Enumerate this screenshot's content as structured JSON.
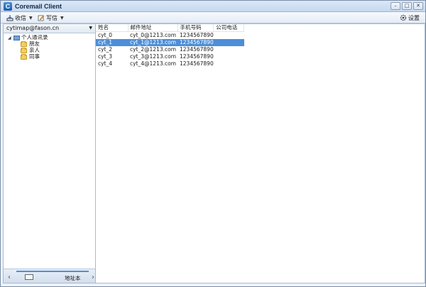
{
  "window": {
    "title": "Coremail Client",
    "icon_letter": "C"
  },
  "window_buttons": {
    "minimize": "–",
    "maximize": "□",
    "close": "✕"
  },
  "toolbar": {
    "receive": "收信",
    "write": "写信",
    "settings": "设置"
  },
  "sidebar": {
    "account": "cytimap@fason.cn",
    "tree": {
      "root": "个人通讯录",
      "children": [
        "朋友",
        "亲人",
        "同事"
      ]
    },
    "bottom": {
      "label": "地址本"
    }
  },
  "table": {
    "columns": [
      "姓名",
      "邮件地址",
      "手机号码",
      "公司电话"
    ],
    "rows": [
      [
        "cyt_0",
        "cyt_0@1213.com",
        "1234567890",
        ""
      ],
      [
        "cyt_1",
        "cyt_1@1213.com",
        "1234567890",
        ""
      ],
      [
        "cyt_2",
        "cyt_2@1213.com",
        "1234567890",
        ""
      ],
      [
        "cyt_3",
        "cyt_3@1213.com",
        "1234567890",
        ""
      ],
      [
        "cyt_4",
        "cyt_4@1213.com",
        "1234567890",
        ""
      ]
    ],
    "selected_row": 1
  },
  "colors": {
    "accent": "#4c8ed8",
    "titlebar": "#c6d9ef"
  }
}
